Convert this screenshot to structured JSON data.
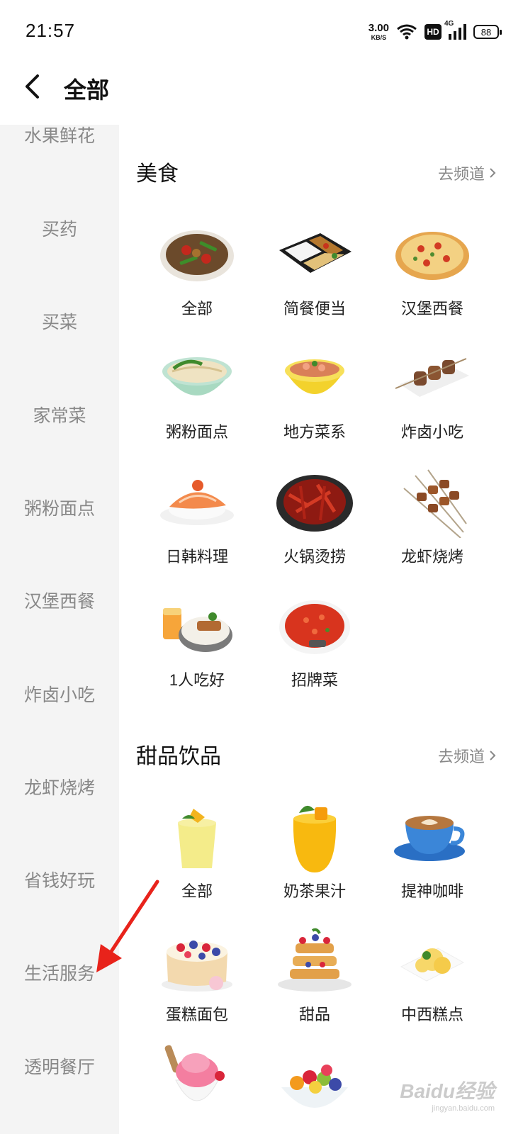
{
  "status_bar": {
    "time": "21:57",
    "net_speed": "3.00",
    "net_unit": "KB/S",
    "hd": "HD",
    "network": "4G",
    "battery": "88"
  },
  "header": {
    "title": "全部"
  },
  "sidebar": {
    "items": [
      {
        "label": "水果鲜花"
      },
      {
        "label": "买药"
      },
      {
        "label": "买菜"
      },
      {
        "label": "家常菜"
      },
      {
        "label": "粥粉面点"
      },
      {
        "label": "汉堡西餐"
      },
      {
        "label": "炸卤小吃"
      },
      {
        "label": "龙虾烧烤"
      },
      {
        "label": "省钱好玩"
      },
      {
        "label": "生活服务"
      },
      {
        "label": "透明餐厅"
      }
    ]
  },
  "sections": [
    {
      "title": "美食",
      "link": "去频道",
      "items": [
        {
          "label": "全部",
          "icon": "stir-fry-plate-icon"
        },
        {
          "label": "简餐便当",
          "icon": "bento-box-icon"
        },
        {
          "label": "汉堡西餐",
          "icon": "pizza-icon"
        },
        {
          "label": "粥粉面点",
          "icon": "noodle-bowl-icon"
        },
        {
          "label": "地方菜系",
          "icon": "regional-dish-bowl-icon"
        },
        {
          "label": "炸卤小吃",
          "icon": "skewer-plate-icon"
        },
        {
          "label": "日韩料理",
          "icon": "sushi-icon"
        },
        {
          "label": "火锅烫捞",
          "icon": "hotpot-icon"
        },
        {
          "label": "龙虾烧烤",
          "icon": "bbq-skewers-icon"
        },
        {
          "label": "1人吃好",
          "icon": "single-meal-icon"
        },
        {
          "label": "招牌菜",
          "icon": "signature-dish-icon"
        }
      ]
    },
    {
      "title": "甜品饮品",
      "link": "去频道",
      "items": [
        {
          "label": "全部",
          "icon": "juice-glass-icon"
        },
        {
          "label": "奶茶果汁",
          "icon": "mango-juice-icon"
        },
        {
          "label": "提神咖啡",
          "icon": "coffee-cup-icon"
        },
        {
          "label": "蛋糕面包",
          "icon": "berry-cake-icon"
        },
        {
          "label": "甜品",
          "icon": "waffle-stack-icon"
        },
        {
          "label": "中西糕点",
          "icon": "pastry-icon"
        },
        {
          "label": "",
          "icon": "ice-cream-icon"
        },
        {
          "label": "",
          "icon": "fruit-bowl-icon"
        }
      ]
    }
  ],
  "watermark": {
    "text": "Baidu经验",
    "sub": "jingyan.baidu.com"
  },
  "colors": {
    "sidebar_bg": "#f4f4f4",
    "sidebar_text": "#888888",
    "annotation": "#e8231b"
  }
}
